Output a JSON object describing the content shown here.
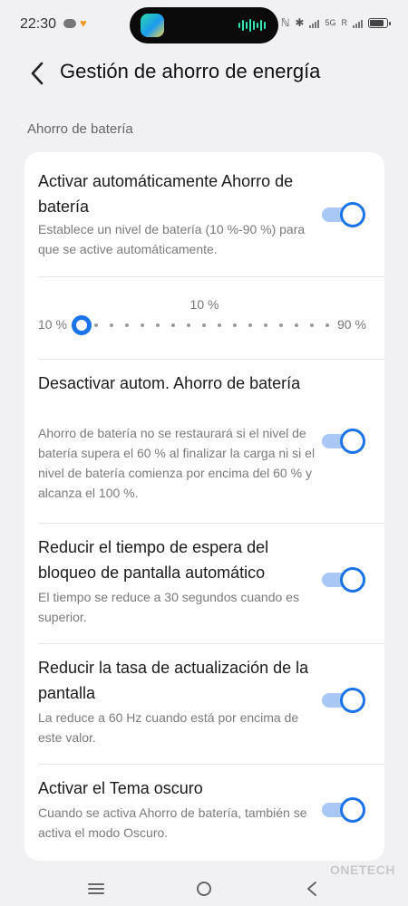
{
  "status_bar": {
    "time": "22:30",
    "network": "5G",
    "carrier_letter": "R"
  },
  "header": {
    "title": "Gestión de ahorro de energía"
  },
  "section": {
    "label": "Ahorro de batería"
  },
  "settings": [
    {
      "title": "Activar automáticamente Ahorro de batería",
      "description": "Establece un nivel de batería (10 %-90 %) para que se active automáticamente.",
      "enabled": true
    },
    {
      "title": "Desactivar autom. Ahorro de batería",
      "description": "Ahorro de batería no se restaurará si el nivel de batería supera el 60 % al finalizar la carga ni si el nivel de batería comienza por encima del 60 % y alcanza el 100 %.",
      "enabled": true
    },
    {
      "title": "Reducir el tiempo de espera del bloqueo de pantalla automático",
      "description": "El tiempo se reduce a 30 segundos cuando es superior.",
      "enabled": true
    },
    {
      "title": "Reducir la tasa de actualización de la pantalla",
      "description": "La reduce a 60 Hz cuando está por encima de este valor.",
      "enabled": true
    },
    {
      "title": "Activar el Tema oscuro",
      "description": "Cuando se activa Ahorro de batería, también se activa el modo Oscuro.",
      "enabled": true
    }
  ],
  "slider": {
    "current_label": "10 %",
    "min_label": "10 %",
    "max_label": "90 %",
    "value": 10,
    "min": 10,
    "max": 90
  },
  "watermark": "ONETECH",
  "colors": {
    "accent": "#1a73e8",
    "toggle_track": "#a9c8f5",
    "background": "#f1f1f3",
    "card": "#ffffff"
  }
}
